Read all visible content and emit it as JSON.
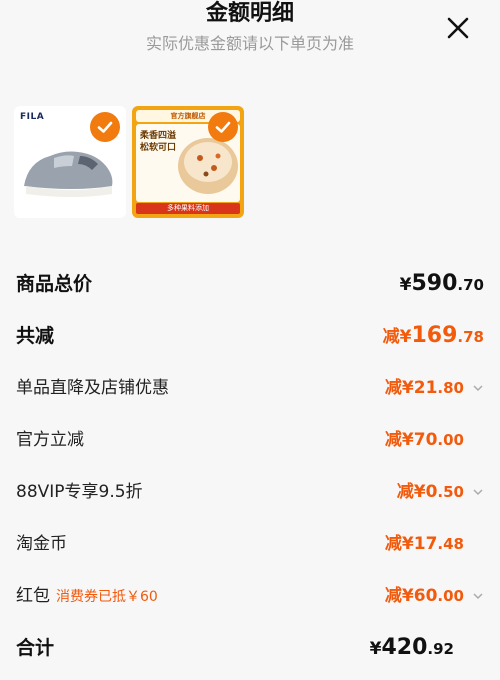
{
  "header": {
    "title": "金额明细",
    "subtitle": "实际优惠金额请以下单页为准"
  },
  "items": [
    {
      "brand_text": "FILA",
      "selected": true
    },
    {
      "badge_text": "官方旗舰店",
      "promo_text": "柔香四溢 松软可口",
      "cta_text": "多种果料添加",
      "selected": true
    }
  ],
  "summary": {
    "total_label": "商品总价",
    "total_currency": "¥",
    "total_int": "590",
    "total_dec": ".70",
    "discount_label": "共减",
    "discount_prefix": "减¥",
    "discount_int": "169",
    "discount_dec": ".78",
    "lines": [
      {
        "label": "单品直降及店铺优惠",
        "prefix": "减¥",
        "int": "21",
        "dec": ".80",
        "tag": ""
      },
      {
        "label": "官方立减",
        "prefix": "减¥",
        "int": "70",
        "dec": ".00",
        "tag": ""
      },
      {
        "label": "88VIP专享9.5折",
        "prefix": "减¥",
        "int": "0",
        "dec": ".50",
        "tag": ""
      },
      {
        "label": "淘金币",
        "prefix": "减¥",
        "int": "17",
        "dec": ".48",
        "tag": ""
      },
      {
        "label": "红包",
        "prefix": "减¥",
        "int": "60",
        "dec": ".00",
        "tag": "消费券已抵￥60"
      }
    ],
    "final_label": "合计",
    "final_currency": "¥",
    "final_int": "420",
    "final_dec": ".92"
  },
  "colors": {
    "accent": "#f25a0c",
    "check": "#f27b10"
  },
  "icons": {
    "close": "close-icon",
    "check": "check-icon",
    "expand": "chevron-down-icon"
  }
}
